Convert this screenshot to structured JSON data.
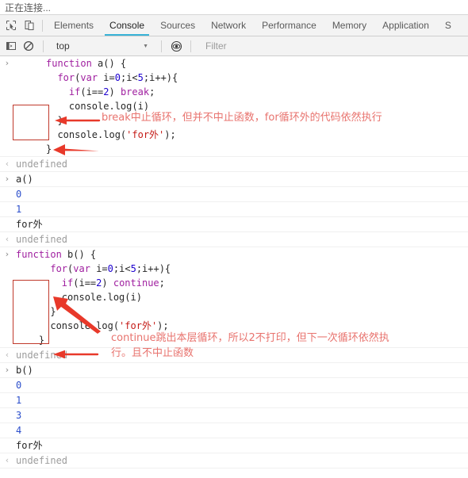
{
  "window": {
    "status_text": "正在连接..."
  },
  "toolbar": {
    "inspect_icon": "inspect-element-icon",
    "device_icon": "device-toolbar-icon",
    "tabs": [
      {
        "label": "Elements",
        "active": false
      },
      {
        "label": "Console",
        "active": true
      },
      {
        "label": "Sources",
        "active": false
      },
      {
        "label": "Network",
        "active": false
      },
      {
        "label": "Performance",
        "active": false
      },
      {
        "label": "Memory",
        "active": false
      },
      {
        "label": "Application",
        "active": false
      },
      {
        "label": "S",
        "active": false
      }
    ]
  },
  "filterbar": {
    "sidebar_icon": "console-sidebar-icon",
    "clear_icon": "clear-console-icon",
    "context": "top",
    "caret": "▼",
    "eye_icon": "live-expression-eye-icon",
    "filter_placeholder": "Filter"
  },
  "console": {
    "gutter_input": "›",
    "gutter_output": "‹",
    "gutter_prompt": "›",
    "entries": [
      {
        "type": "input-code",
        "lines": [
          "function a() {",
          "  for(var i=0;i<5;i++){",
          "    if(i==2) break;",
          "    console.log(i)",
          "  }",
          "  console.log('for外');",
          "}"
        ]
      },
      {
        "type": "result",
        "text": "undefined"
      },
      {
        "type": "input",
        "text": "a()"
      },
      {
        "type": "log-num",
        "text": "0"
      },
      {
        "type": "log-num",
        "text": "1"
      },
      {
        "type": "log",
        "text": "for外"
      },
      {
        "type": "result",
        "text": "undefined"
      },
      {
        "type": "input-code",
        "lines": [
          "function b() {",
          "    for(var i=0;i<5;i++){",
          "      if(i==2) continue;",
          "      console.log(i)",
          "    }",
          "    console.log('for外');",
          "  }"
        ]
      },
      {
        "type": "result",
        "text": "undefined"
      },
      {
        "type": "input",
        "text": "b()"
      },
      {
        "type": "log-num",
        "text": "0"
      },
      {
        "type": "log-num",
        "text": "1"
      },
      {
        "type": "log-num",
        "text": "3"
      },
      {
        "type": "log-num",
        "text": "4"
      },
      {
        "type": "log",
        "text": "for外"
      },
      {
        "type": "result",
        "text": "undefined"
      },
      {
        "type": "prompt",
        "text": ""
      }
    ]
  },
  "annotations": {
    "break_note": "break中止循环，但并不中止函数，for循环外的代码依然执行",
    "continue_note": "continue跳出本层循环，所以2不打印，但下一次循环依然执\n行。且不中止函数",
    "accent_color": "#e8736e",
    "box_color": "#c0392b"
  }
}
